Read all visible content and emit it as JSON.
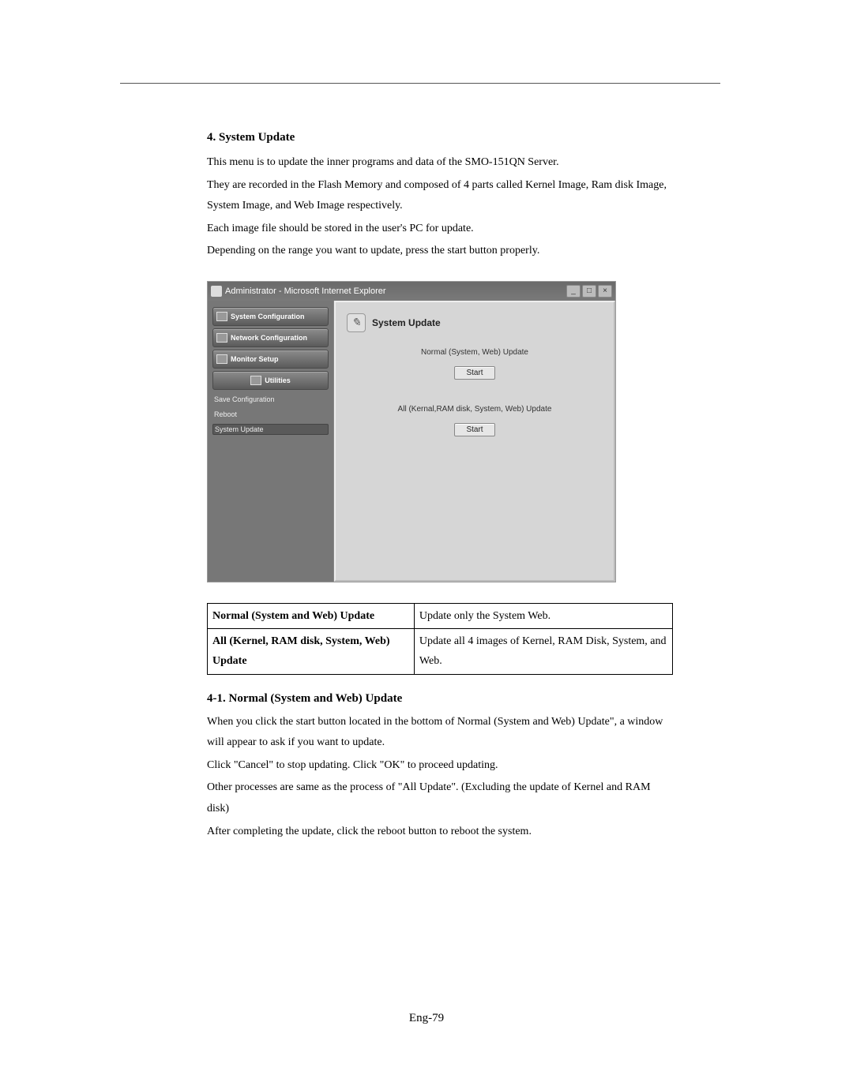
{
  "section": {
    "title": "4. System Update",
    "p1": "This menu is to update the inner programs and data of the SMO-151QN Server.",
    "p2": "They are recorded in the Flash Memory and composed of 4 parts called Kernel Image, Ram disk Image, System Image, and Web Image respectively.",
    "p3": "Each image file should be stored in the user's PC for update.",
    "p4": "Depending on the range you want to update, press the start button properly."
  },
  "window": {
    "title": "Administrator - Microsoft Internet Explorer",
    "min": "_",
    "max": "□",
    "close": "×",
    "sidebar": {
      "system_config": "System Configuration",
      "network_config": "Network Configuration",
      "monitor_setup": "Monitor Setup",
      "utilities": "Utilities",
      "save_config": "Save Configuration",
      "reboot": "Reboot",
      "system_update": "System Update"
    },
    "panel": {
      "title": "System Update",
      "normal_label": "Normal (System, Web) Update",
      "normal_start": "Start",
      "all_label": "All (Kernal,RAM disk, System, Web) Update",
      "all_start": "Start"
    }
  },
  "table": {
    "row1": {
      "k": "Normal (System and Web) Update",
      "v": "Update only the System Web."
    },
    "row2": {
      "k": "All (Kernel, RAM disk, System, Web) Update",
      "v": "Update all 4 images of Kernel, RAM Disk, System, and Web."
    }
  },
  "sub": {
    "title": "4-1. Normal (System and Web) Update",
    "p1": "When you click the start button located in the bottom of Normal (System and Web) Update\", a window will appear to ask if you want to update.",
    "p2": "Click \"Cancel\" to stop updating. Click \"OK\" to proceed updating.",
    "p3": "Other processes are same as the process of \"All Update\". (Excluding the update of Kernel and RAM disk)",
    "p4": "After completing the update, click the reboot button to reboot the system."
  },
  "page_num": "Eng-79"
}
